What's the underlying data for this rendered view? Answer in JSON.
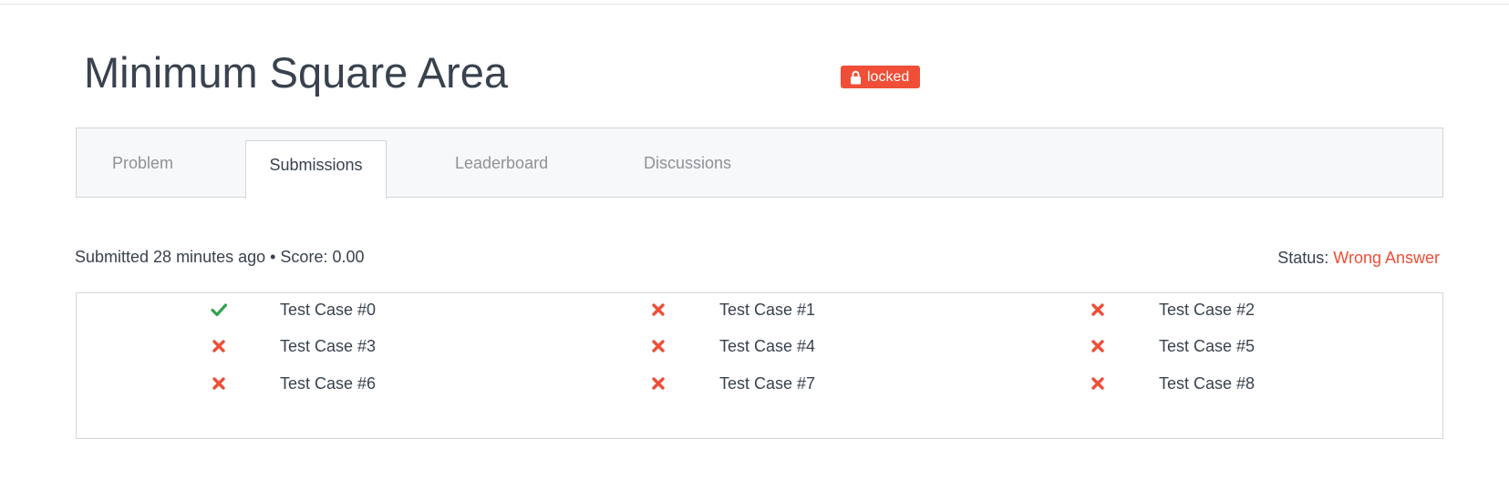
{
  "title": "Minimum Square Area",
  "badge": {
    "label": "locked",
    "icon": "lock-icon",
    "color": "#f04e37"
  },
  "tabs": [
    {
      "label": "Problem",
      "active": false
    },
    {
      "label": "Submissions",
      "active": true
    },
    {
      "label": "Leaderboard",
      "active": false
    },
    {
      "label": "Discussions",
      "active": false
    }
  ],
  "submission": {
    "summary": "Submitted 28 minutes ago • Score: 0.00",
    "status_label": "Status:",
    "status_value": "Wrong Answer",
    "status_color": "#f04e37"
  },
  "test_cases": [
    {
      "label": "Test Case #0",
      "passed": true,
      "icon": "check-icon"
    },
    {
      "label": "Test Case #1",
      "passed": false,
      "icon": "cross-icon"
    },
    {
      "label": "Test Case #2",
      "passed": false,
      "icon": "cross-icon"
    },
    {
      "label": "Test Case #3",
      "passed": false,
      "icon": "cross-icon"
    },
    {
      "label": "Test Case #4",
      "passed": false,
      "icon": "cross-icon"
    },
    {
      "label": "Test Case #5",
      "passed": false,
      "icon": "cross-icon"
    },
    {
      "label": "Test Case #6",
      "passed": false,
      "icon": "cross-icon"
    },
    {
      "label": "Test Case #7",
      "passed": false,
      "icon": "cross-icon"
    },
    {
      "label": "Test Case #8",
      "passed": false,
      "icon": "cross-icon"
    }
  ],
  "colors": {
    "pass": "#2ea44f",
    "fail": "#f04e37"
  }
}
